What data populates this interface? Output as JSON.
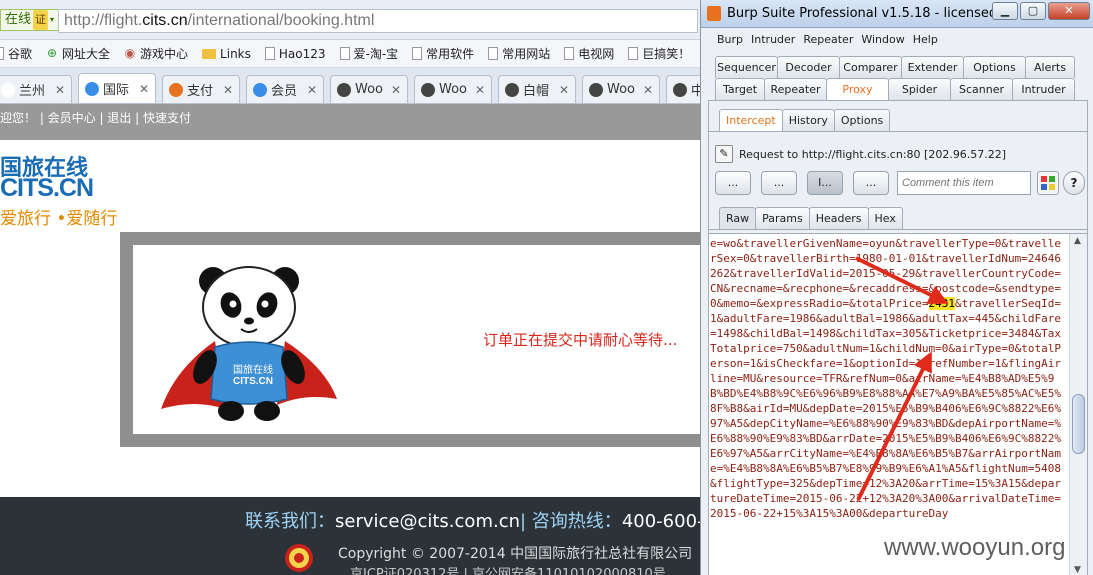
{
  "browser": {
    "security_badge": "在线",
    "security_badge_cert": "证",
    "url_prefix": "http://flight.",
    "url_domain": "cits.cn",
    "url_path": "/international/booking.html",
    "bookmarks": [
      {
        "label": "谷歌",
        "icon": "page"
      },
      {
        "label": "网址大全",
        "icon": "plus-circle"
      },
      {
        "label": "游戏中心",
        "icon": "gamepad"
      },
      {
        "label": "Links",
        "icon": "folder"
      },
      {
        "label": "Hao123",
        "icon": "page"
      },
      {
        "label": "爱-淘-宝",
        "icon": "page"
      },
      {
        "label": "常用软件",
        "icon": "page"
      },
      {
        "label": "常用网站",
        "icon": "page"
      },
      {
        "label": "电视网",
        "icon": "page"
      },
      {
        "label": "巨搞笑！",
        "icon": "page"
      }
    ],
    "tabs": [
      {
        "label": "兰州",
        "color": "#ffffff",
        "active": false
      },
      {
        "label": "国际",
        "color": "#3b8ee8",
        "active": true
      },
      {
        "label": "支付",
        "color": "#e8721d",
        "active": false
      },
      {
        "label": "会员",
        "color": "#3b8ee8",
        "active": false
      },
      {
        "label": "Woo",
        "color": "#444444",
        "active": false
      },
      {
        "label": "Woo",
        "color": "#444444",
        "active": false
      },
      {
        "label": "白帽",
        "color": "#444444",
        "active": false
      },
      {
        "label": "Woo",
        "color": "#444444",
        "active": false
      },
      {
        "label": "中",
        "color": "#444444",
        "active": false
      }
    ]
  },
  "site": {
    "topbar": "迎您！ | 会员中心 | 退出 | 快速支付",
    "logo_cn": "国旅在线",
    "logo_en": "CITS.CN",
    "logo_slogan": "爱旅行 •爱随行",
    "panda_badge_cn": "国旅在线",
    "panda_badge_en": "CITS.CN",
    "loading_text": "订单正在提交中请耐心等待...",
    "footer_contact_label": "联系我们：",
    "footer_contact_email": "service@cits.com.cn",
    "footer_hotline_label": "| 咨询热线：",
    "footer_hotline": "400-600-8",
    "footer_copyright": "Copyright © 2007-2014 中国国际旅行社总社有限公司",
    "footer_icp": "京ICP证020312号 | 京公网安备11010102000810号"
  },
  "burp": {
    "title": "Burp Suite Professional v1.5.18 - licensed t...",
    "win_min": "▁",
    "win_max": "▢",
    "win_close": "✕",
    "menu": [
      "Burp",
      "Intruder",
      "Repeater",
      "Window",
      "Help"
    ],
    "tabs_row1": [
      "Sequencer",
      "Decoder",
      "Comparer",
      "Extender",
      "Options",
      "Alerts"
    ],
    "tabs_row2": [
      "Target",
      "Repeater",
      "Proxy",
      "Spider",
      "Scanner",
      "Intruder"
    ],
    "selected_main_tab": "Proxy",
    "proxy_tabs": [
      "Intercept",
      "History",
      "Options"
    ],
    "request_info": "Request to http://flight.cits.cn:80  [202.96.57.22]",
    "buttons": [
      "...",
      "...",
      "I...",
      "..."
    ],
    "comment_placeholder": "Comment this item",
    "help": "?",
    "view_tabs": [
      "Raw",
      "Params",
      "Headers",
      "Hex"
    ],
    "raw_before": "e=wo&travellerGivenName=oyun&travellerType=0&travellerSex=0&travellerBirth=1980-01-01&travellerIdNum=24646262&travellerIdValid=2015-05-29&travellerCountryCode=CN&recname=&recphone=&recaddress=&postcode=&sendtype=0&memo=&expressRadio=&totalPrice=",
    "raw_highlight": "2431",
    "raw_after": "&travellerSeqId=1&adultFare=1986&adultBal=1986&adultTax=445&childFare=1498&childBal=1498&childTax=305&Ticketprice=3484&TaxTotalprice=750&adultNum=1&childNum=0&airType=0&totalPerson=1&isCheckfare=1&optionId=1&refNumber=1&flingAirline=MU&resource=TFR&refNum=0&airName=%E4%B8%AD%E5%9B%BD%E4%B8%9C%E6%96%B9%E8%88%AA%E7%A9%BA%E5%85%AC%E5%8F%B8&airId=MU&depDate=2015%E5%B9%B406%E6%9C%8822%E6%97%A5&depCityName=%E6%88%90%E9%83%BD&depAirportName=%E6%88%90%E9%83%BD&arrDate=2015%E5%B9%B406%E6%9C%8822%E6%97%A5&arrCityName=%E4%B8%8A%E6%B5%B7&arrAirportName=%E4%B8%8A%E6%B5%B7%E8%99%B9%E6%A1%A5&flightNum=5408&flightType=325&depTime=12%3A20&arrTime=15%3A15&departureDateTime=2015-06-22+12%3A20%3A00&arrivalDateTime=2015-06-22+15%3A15%3A00&departureDay"
  },
  "watermark": "www.wooyun.org"
}
